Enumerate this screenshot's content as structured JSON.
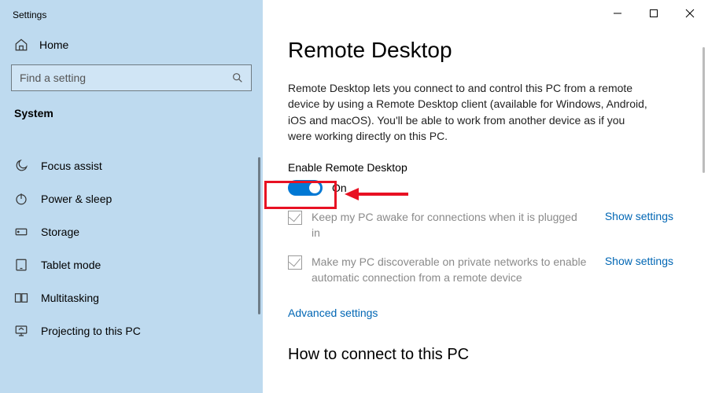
{
  "window": {
    "app_title": "Settings"
  },
  "sidebar": {
    "home_label": "Home",
    "search_placeholder": "Find a setting",
    "section_label": "System",
    "items": [
      {
        "label": "Focus assist",
        "icon": "moon-icon"
      },
      {
        "label": "Power & sleep",
        "icon": "power-icon"
      },
      {
        "label": "Storage",
        "icon": "storage-icon"
      },
      {
        "label": "Tablet mode",
        "icon": "tablet-icon"
      },
      {
        "label": "Multitasking",
        "icon": "multitasking-icon"
      },
      {
        "label": "Projecting to this PC",
        "icon": "projecting-icon"
      }
    ]
  },
  "main": {
    "title": "Remote Desktop",
    "description": "Remote Desktop lets you connect to and control this PC from a remote device by using a Remote Desktop client (available for Windows, Android, iOS and macOS). You'll be able to work from another device as if you were working directly on this PC.",
    "enable_label": "Enable Remote Desktop",
    "toggle_state": "On",
    "option1_text": "Keep my PC awake for connections when it is plugged in",
    "option1_link": "Show settings",
    "option2_text": "Make my PC discoverable on private networks to enable automatic connection from a remote device",
    "option2_link": "Show settings",
    "advanced_link": "Advanced settings",
    "subheading": "How to connect to this PC"
  }
}
